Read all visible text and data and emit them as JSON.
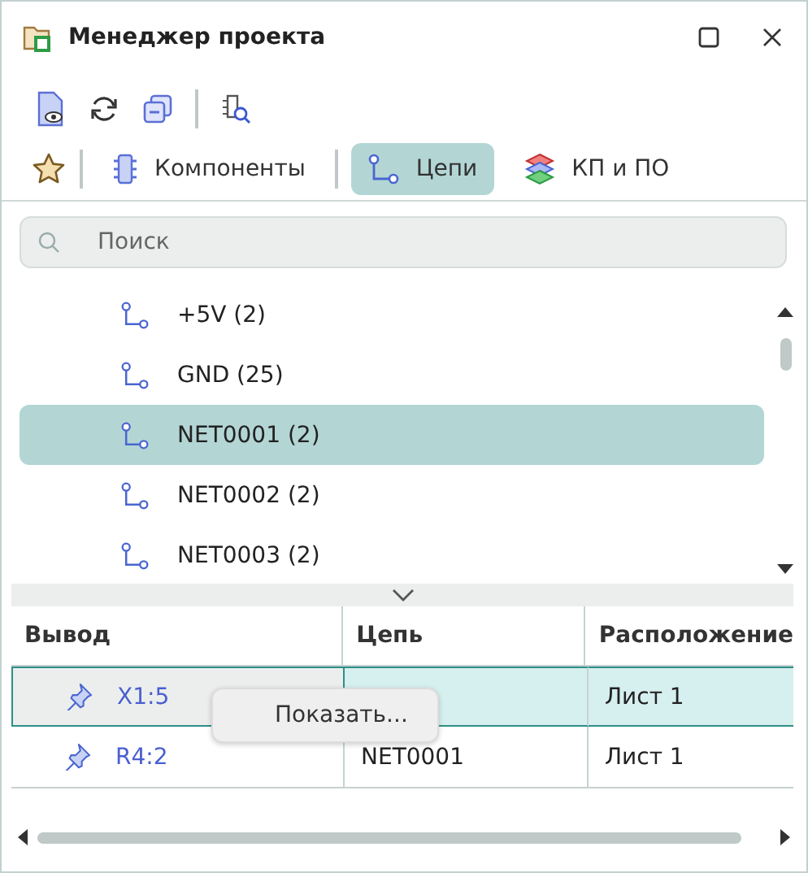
{
  "window": {
    "title": "Менеджер проекта"
  },
  "tabs": [
    {
      "kind": "components",
      "label": "Компоненты",
      "selected": false
    },
    {
      "kind": "nets",
      "label": "Цепи",
      "selected": true
    },
    {
      "kind": "pads",
      "label": "КП и ПО",
      "selected": false
    }
  ],
  "search": {
    "placeholder": "Поиск"
  },
  "nets": [
    {
      "label": "+5V (2)",
      "selected": false
    },
    {
      "label": "GND (25)",
      "selected": false
    },
    {
      "label": "NET0001 (2)",
      "selected": true
    },
    {
      "label": "NET0002 (2)",
      "selected": false
    },
    {
      "label": "NET0003 (2)",
      "selected": false
    }
  ],
  "table": {
    "columns": [
      "Вывод",
      "Цепь",
      "Расположение"
    ],
    "rows": [
      {
        "pin": "X1:5",
        "location": "Лист 1",
        "selected": true
      },
      {
        "pin": "R4:2",
        "net": "NET0001",
        "location": "Лист 1",
        "selected": false
      }
    ]
  },
  "context_menu": {
    "items": [
      "Показать..."
    ]
  }
}
